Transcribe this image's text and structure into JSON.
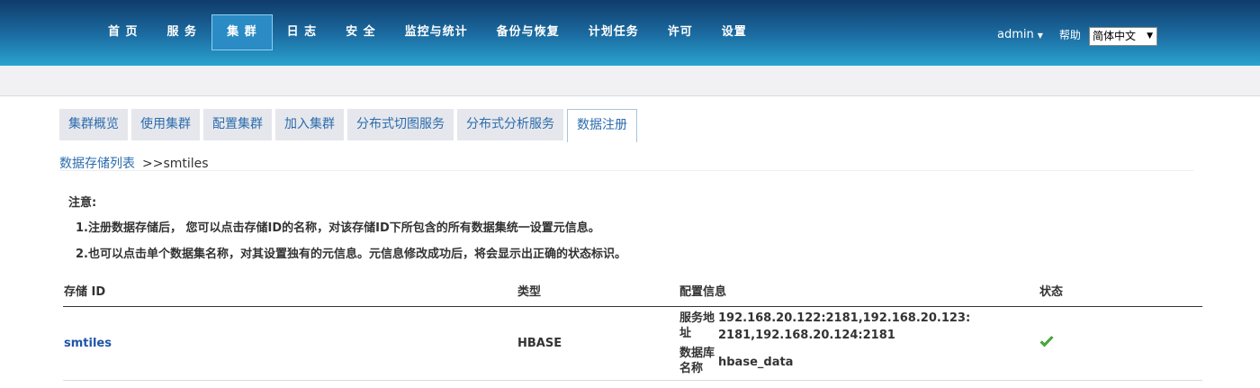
{
  "nav": {
    "items": [
      "首 页",
      "服 务",
      "集 群",
      "日 志",
      "安 全",
      "监控与统计",
      "备份与恢复",
      "计划任务",
      "许可",
      "设置"
    ],
    "active_index": 2,
    "user": "admin",
    "help": "帮助",
    "language": "简体中文"
  },
  "tabs": {
    "items": [
      "集群概览",
      "使用集群",
      "配置集群",
      "加入集群",
      "分布式切图服务",
      "分布式分析服务",
      "数据注册"
    ],
    "active_index": 6
  },
  "breadcrumb": {
    "link": "数据存储列表",
    "current": ">>smtiles"
  },
  "notice": {
    "title": "注意:",
    "line1": "1.注册数据存储后， 您可以点击存储ID的名称，对该存储ID下所包含的所有数据集统一设置元信息。",
    "line2": "2.也可以点击单个数据集名称，对其设置独有的元信息。元信息修改成功后，将会显示出正确的状态标识。"
  },
  "table": {
    "headers": [
      "存储 ID",
      "类型",
      "配置信息",
      "状态"
    ],
    "rows": [
      {
        "id": "smtiles",
        "type": "HBASE",
        "config": {
          "address_label_1": "服务地",
          "address_label_2": "址",
          "address_value_1": "192.168.20.122:2181,192.168.20.123:",
          "address_value_2": "2181,192.168.20.124:2181",
          "db_label_1": "数据库",
          "db_label_2": "名称",
          "db_value": "hbase_data"
        },
        "status": "check-icon"
      }
    ]
  },
  "colors": {
    "accent": "#2b6cad",
    "nav_top": "#0f3b6b",
    "nav_bottom": "#2aa3cf",
    "status_ok": "#4caf3c"
  }
}
